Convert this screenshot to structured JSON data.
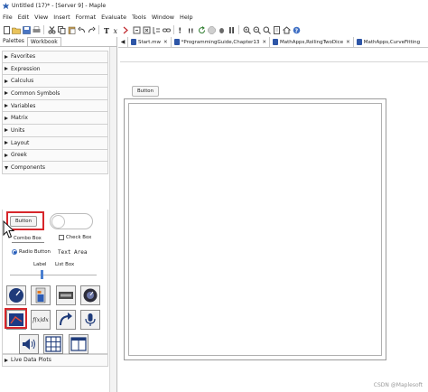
{
  "window": {
    "title": "Untitled (17)* - [Server 9] - Maple"
  },
  "menu": [
    "File",
    "Edit",
    "View",
    "Insert",
    "Format",
    "Evaluate",
    "Tools",
    "Window",
    "Help"
  ],
  "toolbar_icons": [
    "new-document-icon",
    "open-folder-icon",
    "save-icon",
    "print-icon",
    "cut-icon",
    "copy-icon",
    "paste-icon",
    "undo-icon",
    "redo-icon",
    "text-mode-icon",
    "math-mode-icon",
    "insert-prompt-icon",
    "insert-section-icon",
    "delete-section-icon",
    "execution-group-icon",
    "link-icon",
    "execute-icon",
    "execute-all-icon",
    "restart-icon",
    "stop-icon",
    "debug-icon",
    "pause-icon",
    "zoom-in-icon",
    "zoom-out-icon",
    "zoom-icon",
    "page-icon",
    "home-icon",
    "help-icon"
  ],
  "palettes": {
    "tabs": [
      "Palettes",
      "Workbook"
    ],
    "sections": [
      "Favorites",
      "Expression",
      "Calculus",
      "Common Symbols",
      "Variables",
      "Matrix",
      "Units",
      "Layout",
      "Greek"
    ],
    "expanded_section": "Components",
    "components": {
      "button_label": "Button",
      "combo_box": "Combo Box",
      "check_box": "Check Box",
      "radio_button": "Radio Button",
      "text_area": "Text Area",
      "label": "Label",
      "list_box": "List Box",
      "math_container_glyph": "f(x)dx"
    },
    "after_section": "Live Data Plots"
  },
  "doc_tabs": [
    "Start.mw",
    "*ProgrammingGuide,Chapter13",
    "MathApps,RollingTwoDice",
    "MathApps,CurveFitting"
  ],
  "worksheet": {
    "button_label": "Button"
  },
  "watermark": "CSDN @Maplesoft"
}
